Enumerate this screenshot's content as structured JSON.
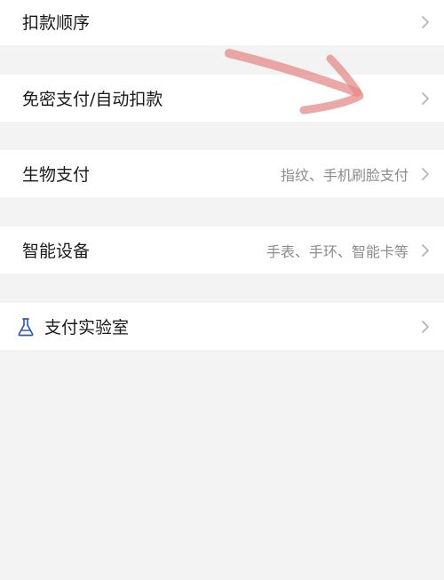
{
  "rows": [
    {
      "label": "扣款顺序",
      "sub": ""
    },
    {
      "label": "免密支付/自动扣款",
      "sub": ""
    },
    {
      "label": "生物支付",
      "sub": "指纹、手机刷脸支付"
    },
    {
      "label": "智能设备",
      "sub": "手表、手环、智能卡等"
    },
    {
      "label": "支付实验室",
      "sub": "",
      "icon": "flask-icon"
    }
  ],
  "icons": {
    "chevron": "chevron-right-icon",
    "lab": "flask-icon"
  },
  "colors": {
    "background": "#f3f3f3",
    "row_background": "#ffffff",
    "label_text": "#1a1a1a",
    "sub_text": "#8c8c8c",
    "chevron": "#b5b5b5",
    "lab_icon": "#2f5bb5",
    "annotation_arrow": "#e58a8a"
  }
}
